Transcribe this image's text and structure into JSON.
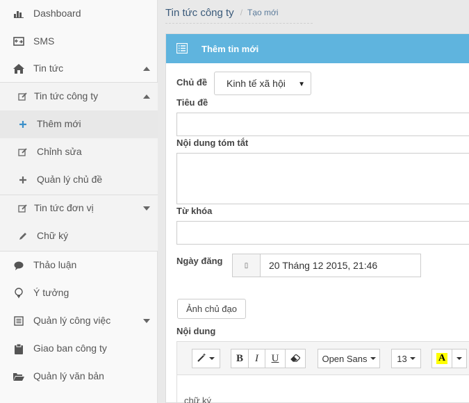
{
  "sidebar": {
    "items": [
      {
        "label": "Dashboard",
        "icon": "bar-chart-icon"
      },
      {
        "label": "SMS",
        "icon": "sms-icon"
      },
      {
        "label": "Tin tức",
        "icon": "home-icon"
      },
      {
        "label": "Tin tức công ty",
        "icon": "edit-icon"
      },
      {
        "label": "Thêm mới",
        "icon": "plus-icon"
      },
      {
        "label": "Chỉnh sửa",
        "icon": "edit-icon"
      },
      {
        "label": "Quản lý chủ đề",
        "icon": "plus-icon"
      },
      {
        "label": "Tin tức đơn vị",
        "icon": "edit-icon"
      },
      {
        "label": "Chữ ký",
        "icon": "pencil-icon"
      },
      {
        "label": "Thảo luận",
        "icon": "comment-icon"
      },
      {
        "label": "Ý tưởng",
        "icon": "lightbulb-icon"
      },
      {
        "label": "Quản lý công việc",
        "icon": "list-icon"
      },
      {
        "label": "Giao ban công ty",
        "icon": "clipboard-icon"
      },
      {
        "label": "Quản lý văn bản",
        "icon": "folder-open-icon"
      }
    ]
  },
  "breadcrumb": {
    "home": "Tin tức công ty",
    "current": "Tạo mới"
  },
  "panel": {
    "title": "Thêm tin mới",
    "header_color": "#5fb4de"
  },
  "form": {
    "topic_label": "Chủ đề",
    "topic_value": "Kinh tế xã hội",
    "title_label": "Tiêu đề",
    "summary_label": "Nội dung tóm tắt",
    "keywords_label": "Từ khóa",
    "date_label": "Ngày đăng",
    "date_value": "20 Tháng 12 2015, 21:46",
    "image_button": "Ảnh chủ đạo",
    "content_label": "Nội dung"
  },
  "editor": {
    "bold": "B",
    "italic": "I",
    "underline": "U",
    "font_family": "Open Sans",
    "font_size": "13",
    "color_letter": "A",
    "body_text": "chữ ký"
  }
}
